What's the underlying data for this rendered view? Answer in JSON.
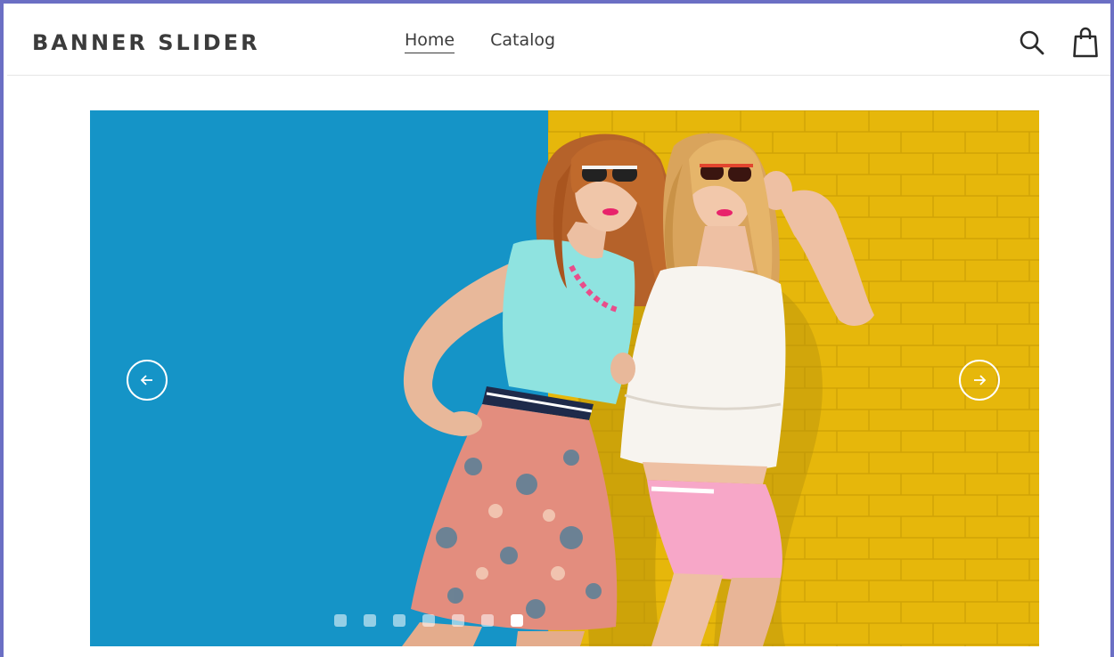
{
  "header": {
    "logo": "BANNER SLIDER",
    "nav": [
      {
        "label": "Home",
        "active": true
      },
      {
        "label": "Catalog",
        "active": false
      }
    ],
    "icons": [
      "search-icon",
      "cart-icon"
    ]
  },
  "slider": {
    "prev_icon": "arrow-left-icon",
    "next_icon": "arrow-right-icon",
    "dot_count": 7,
    "active_dot": 7,
    "colors": {
      "left_panel": "#1594c7",
      "right_panel": "#e6b70b"
    }
  }
}
